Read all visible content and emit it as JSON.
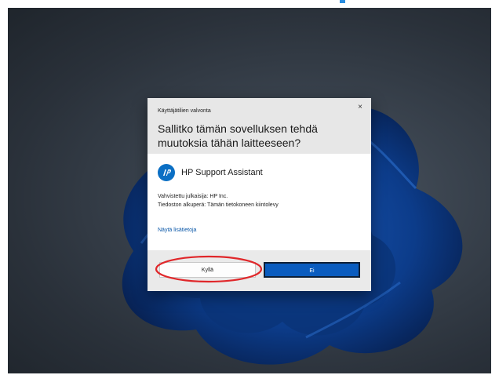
{
  "uac": {
    "caption": "Käyttäjätilien valvonta",
    "close_glyph": "×",
    "question": "Sallitko tämän sovelluksen tehdä muutoksia tähän laitteeseen?",
    "app_name": "HP Support Assistant",
    "publisher_line": "Vahvistettu julkaisija: HP Inc.",
    "origin_line": "Tiedoston alkuperä: Tämän tietokoneen kiintolevy",
    "details_link": "Näytä lisätietoja",
    "yes_label": "Kyllä",
    "no_label": "Ei"
  },
  "icons": {
    "hp_logo": "hp-logo-icon",
    "close": "close-icon"
  },
  "colors": {
    "accent_blue": "#0a5cbf",
    "link_blue": "#0a57a8",
    "highlight_red": "#e0272a",
    "dialog_header": "#e7e7e7",
    "dialog_footer": "#eaeaea"
  }
}
